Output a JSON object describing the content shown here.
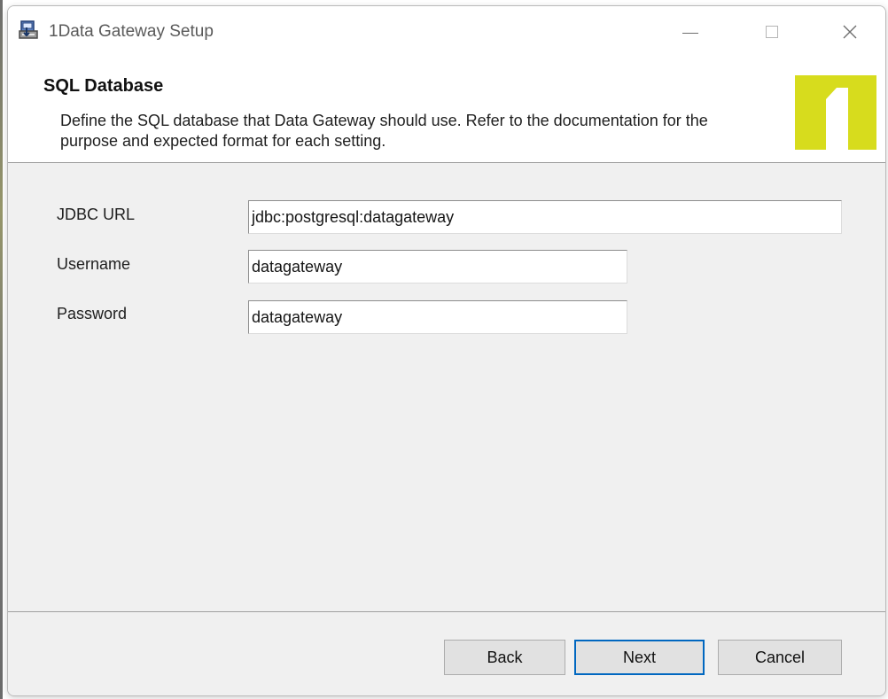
{
  "window": {
    "title": "1Data Gateway Setup",
    "icon": "installer-icon"
  },
  "header": {
    "title": "SQL Database",
    "description": "Define the SQL database that Data Gateway should use. Refer to the documentation for the purpose and expected format for each setting.",
    "logo_text": "1",
    "logo_color": "#d7dc1d"
  },
  "form": {
    "jdbc_url_label": "JDBC URL",
    "jdbc_url_value": "jdbc:postgresql:datagateway",
    "username_label": "Username",
    "username_value": "datagateway",
    "password_label": "Password",
    "password_value": "datagateway"
  },
  "footer": {
    "back_label": "Back",
    "next_label": "Next",
    "cancel_label": "Cancel"
  },
  "colors": {
    "primary_focus": "#0067c0",
    "window_background": "#f0f0f0",
    "header_background": "#ffffff"
  }
}
